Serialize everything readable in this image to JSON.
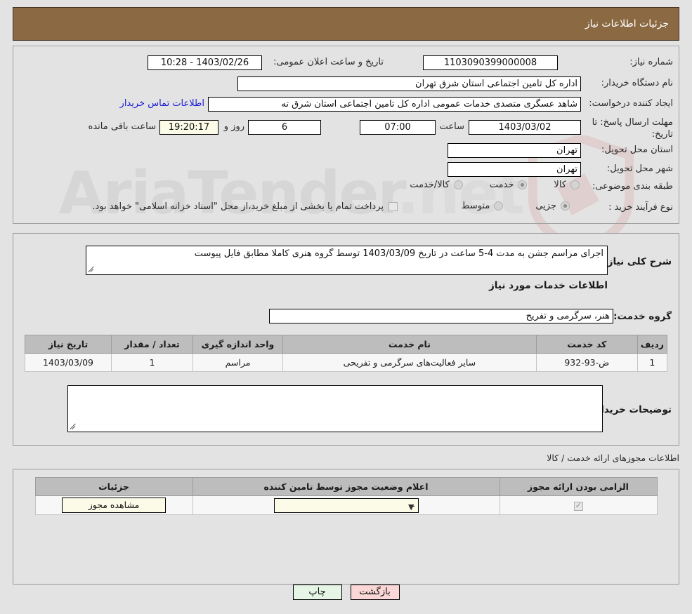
{
  "header": {
    "title": "جزئیات اطلاعات نیاز"
  },
  "form": {
    "need_number_label": "شماره نیاز:",
    "need_number_value": "1103090399000008",
    "announce_datetime_label": "تاریخ و ساعت اعلان عمومی:",
    "announce_datetime_value": "1403/02/26 - 10:28",
    "buyer_org_label": "نام دستگاه خریدار:",
    "buyer_org_value": "اداره کل تامین اجتماعی استان شرق تهران",
    "requester_label": "ایجاد کننده درخواست:",
    "requester_value": "شاهد عسگری متصدی خدمات عمومی اداره کل تامین اجتماعی استان شرق ته",
    "buyer_contact_link": "اطلاعات تماس خریدار",
    "deadline_label_line1": "مهلت ارسال پاسخ: تا",
    "deadline_label_line2": "تاریخ:",
    "deadline_date_value": "1403/03/02",
    "deadline_hour_label": "ساعت",
    "deadline_hour_value": "07:00",
    "remaining_days_value": "6",
    "remaining_days_label": "روز و",
    "remaining_time_value": "19:20:17",
    "remaining_time_label": "ساعت باقی مانده",
    "province_label": "استان محل تحویل:",
    "province_value": "تهران",
    "city_label": "شهر محل تحویل:",
    "city_value": "تهران",
    "category_label": "طبقه بندی موضوعی:",
    "category_options": [
      {
        "label": "کالا",
        "selected": false
      },
      {
        "label": "خدمت",
        "selected": true
      },
      {
        "label": "کالا/خدمت",
        "selected": false
      }
    ],
    "process_label": "نوع فرآیند خرید :",
    "process_options": [
      {
        "label": "جزیی",
        "selected": true
      },
      {
        "label": "متوسط",
        "selected": false
      }
    ],
    "treasury_checkbox_checked": false,
    "treasury_note": "پرداخت تمام یا بخشی از مبلغ خرید،از محل \"اسناد خزانه اسلامی\" خواهد بود."
  },
  "need": {
    "summary_label": "شرح کلی نیاز:",
    "summary_value": "اجرای مراسم جشن به مدت 4-5 ساعت در تاریخ 1403/03/09 توسط گروه هنری کاملا مطابق فایل پیوست",
    "services_section_title": "اطلاعات خدمات مورد نیاز",
    "service_group_label": "گروه خدمت:",
    "service_group_value": "هنر، سرگرمی و تفریح",
    "table": {
      "headers": [
        "ردیف",
        "کد خدمت",
        "نام خدمت",
        "واحد اندازه گیری",
        "تعداد / مقدار",
        "تاریخ نیاز"
      ],
      "rows": [
        [
          "1",
          "ض-93-932",
          "سایر فعالیت‌های سرگرمی و تفریحی",
          "مراسم",
          "1",
          "1403/03/09"
        ]
      ]
    },
    "buyer_notes_label": "توضیحات خریدار:",
    "buyer_notes_value": ""
  },
  "licenses": {
    "section_title": "اطلاعات مجوزهای ارائه خدمت / کالا",
    "headers": [
      "الزامی بودن ارائه مجوز",
      "اعلام وضعیت مجوز توسط تامین کننده",
      "جزئیات"
    ],
    "rows": [
      {
        "required_checked": true,
        "status_value": "--",
        "details_button": "مشاهده مجوز"
      }
    ]
  },
  "footer": {
    "print_label": "چاپ",
    "back_label": "بازگشت"
  },
  "watermark": {
    "text": "AriaTender",
    "suffix": ".net"
  },
  "colors": {
    "title_bar": "#8b6a43",
    "page_bg": "#e3e3e3",
    "link": "#1b1bd4",
    "table_header": "#bdbdbd",
    "print_button": "#e6f5e6",
    "back_button": "#fbd6d6",
    "highlight_field": "#fbfbe8"
  }
}
